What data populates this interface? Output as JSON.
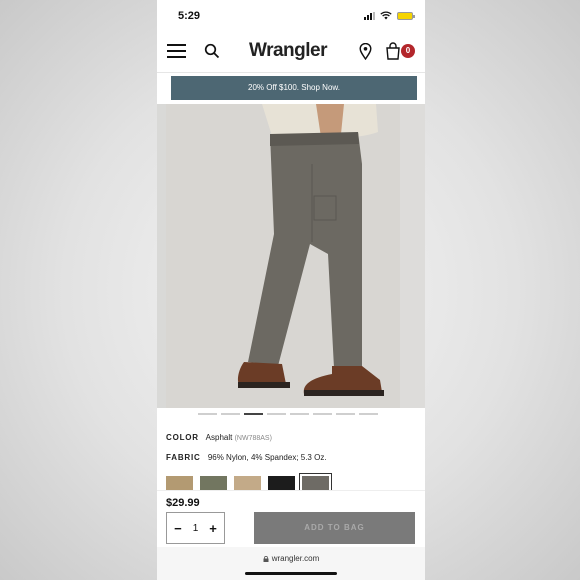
{
  "status_bar": {
    "time": "5:29"
  },
  "header": {
    "logo": "Wrangler",
    "bag_count": "0",
    "icons": [
      "menu-icon",
      "search-icon",
      "location-pin-icon",
      "shopping-bag-icon"
    ]
  },
  "promo": {
    "text": "20% Off $100. Shop Now."
  },
  "carousel": {
    "total": 8,
    "active_index": 2
  },
  "product": {
    "color_label": "COLOR",
    "color_value": "Asphalt",
    "sku": "(NW788AS)",
    "fabric_label": "FABRIC",
    "fabric_value": "96% Nylon, 4% Spandex; 5.3 Oz.",
    "swatches": [
      {
        "name": "tan",
        "color": "#b39a72"
      },
      {
        "name": "olive",
        "color": "#727660"
      },
      {
        "name": "khaki",
        "color": "#c3aa88"
      },
      {
        "name": "black",
        "color": "#1c1c1c"
      },
      {
        "name": "asphalt",
        "color": "#6e6b65",
        "selected": true
      }
    ],
    "price": "$29.99",
    "quantity": "1",
    "add_to_bag_label": "ADD TO BAG"
  },
  "browser": {
    "url": "wrangler.com"
  },
  "colors": {
    "promo_bg": "#4d6773",
    "badge": "#b3262b",
    "button_disabled": "#7a7a7a"
  }
}
